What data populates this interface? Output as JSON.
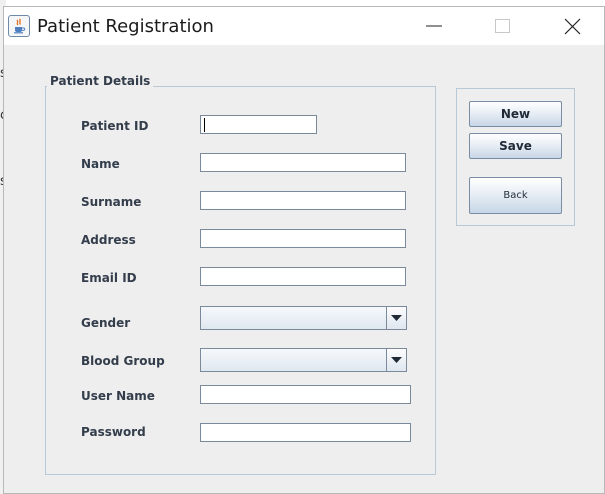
{
  "window": {
    "title": "Patient Registration",
    "icon": "java-coffee-icon"
  },
  "background_window": {
    "edge_chars": [
      "s",
      "c",
      "s"
    ]
  },
  "form": {
    "group_title": "Patient Details",
    "fields": {
      "patient_id": {
        "label": "Patient ID",
        "value": ""
      },
      "name": {
        "label": "Name",
        "value": ""
      },
      "surname": {
        "label": "Surname",
        "value": ""
      },
      "address": {
        "label": "Address",
        "value": ""
      },
      "email": {
        "label": "Email ID",
        "value": ""
      },
      "gender": {
        "label": "Gender",
        "selected": ""
      },
      "blood_group": {
        "label": "Blood Group",
        "selected": ""
      },
      "username": {
        "label": "User Name",
        "value": ""
      },
      "password": {
        "label": "Password",
        "value": ""
      }
    }
  },
  "actions": {
    "new_label": "New",
    "save_label": "Save",
    "back_label": "Back"
  }
}
